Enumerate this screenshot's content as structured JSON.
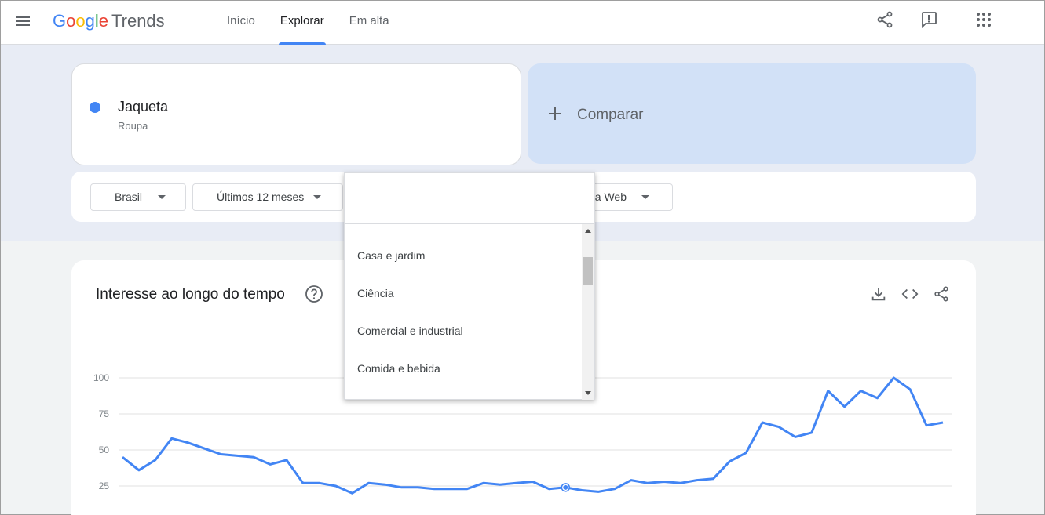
{
  "header": {
    "logo": {
      "g1": "G",
      "g2": "o",
      "g3": "o",
      "g4": "g",
      "g5": "l",
      "g6": "e",
      "trends": "Trends"
    },
    "tabs": [
      {
        "label": "Início",
        "active": false
      },
      {
        "label": "Explorar",
        "active": true
      },
      {
        "label": "Em alta",
        "active": false
      }
    ],
    "icons": [
      "menu-icon",
      "share-icon",
      "feedback-icon",
      "apps-icon"
    ]
  },
  "term": {
    "name": "Jaqueta",
    "category": "Roupa",
    "color": "#4285f4"
  },
  "compare": {
    "label": "Comparar"
  },
  "filters": {
    "region": "Brasil",
    "period": "Últimos 12 meses",
    "search_type_partial": "na Web"
  },
  "dropdown": {
    "search_value": "",
    "items": [
      "Casa e jardim",
      "Ciência",
      "Comercial e industrial",
      "Comida e bebida"
    ]
  },
  "chart": {
    "title": "Interesse ao longo do tempo",
    "icons": [
      "help-icon",
      "download-icon",
      "embed-code-icon",
      "share-icon"
    ]
  },
  "chart_data": {
    "type": "line",
    "title": "Interesse ao longo do tempo",
    "ylim": [
      0,
      100
    ],
    "yticks": [
      25,
      50,
      75,
      100
    ],
    "grid": true,
    "series": [
      {
        "color": "#4285f4",
        "values": [
          45,
          36,
          43,
          58,
          55,
          51,
          47,
          46,
          45,
          40,
          43,
          27,
          27,
          25,
          20,
          27,
          26,
          24,
          24,
          23,
          23,
          23,
          27,
          26,
          27,
          28,
          23,
          24,
          22,
          21,
          23,
          29,
          27,
          28,
          27,
          29,
          30,
          42,
          48,
          69,
          66,
          59,
          62,
          91,
          80,
          91,
          86,
          100,
          92,
          67,
          69
        ]
      }
    ],
    "highlight_index": 27
  }
}
